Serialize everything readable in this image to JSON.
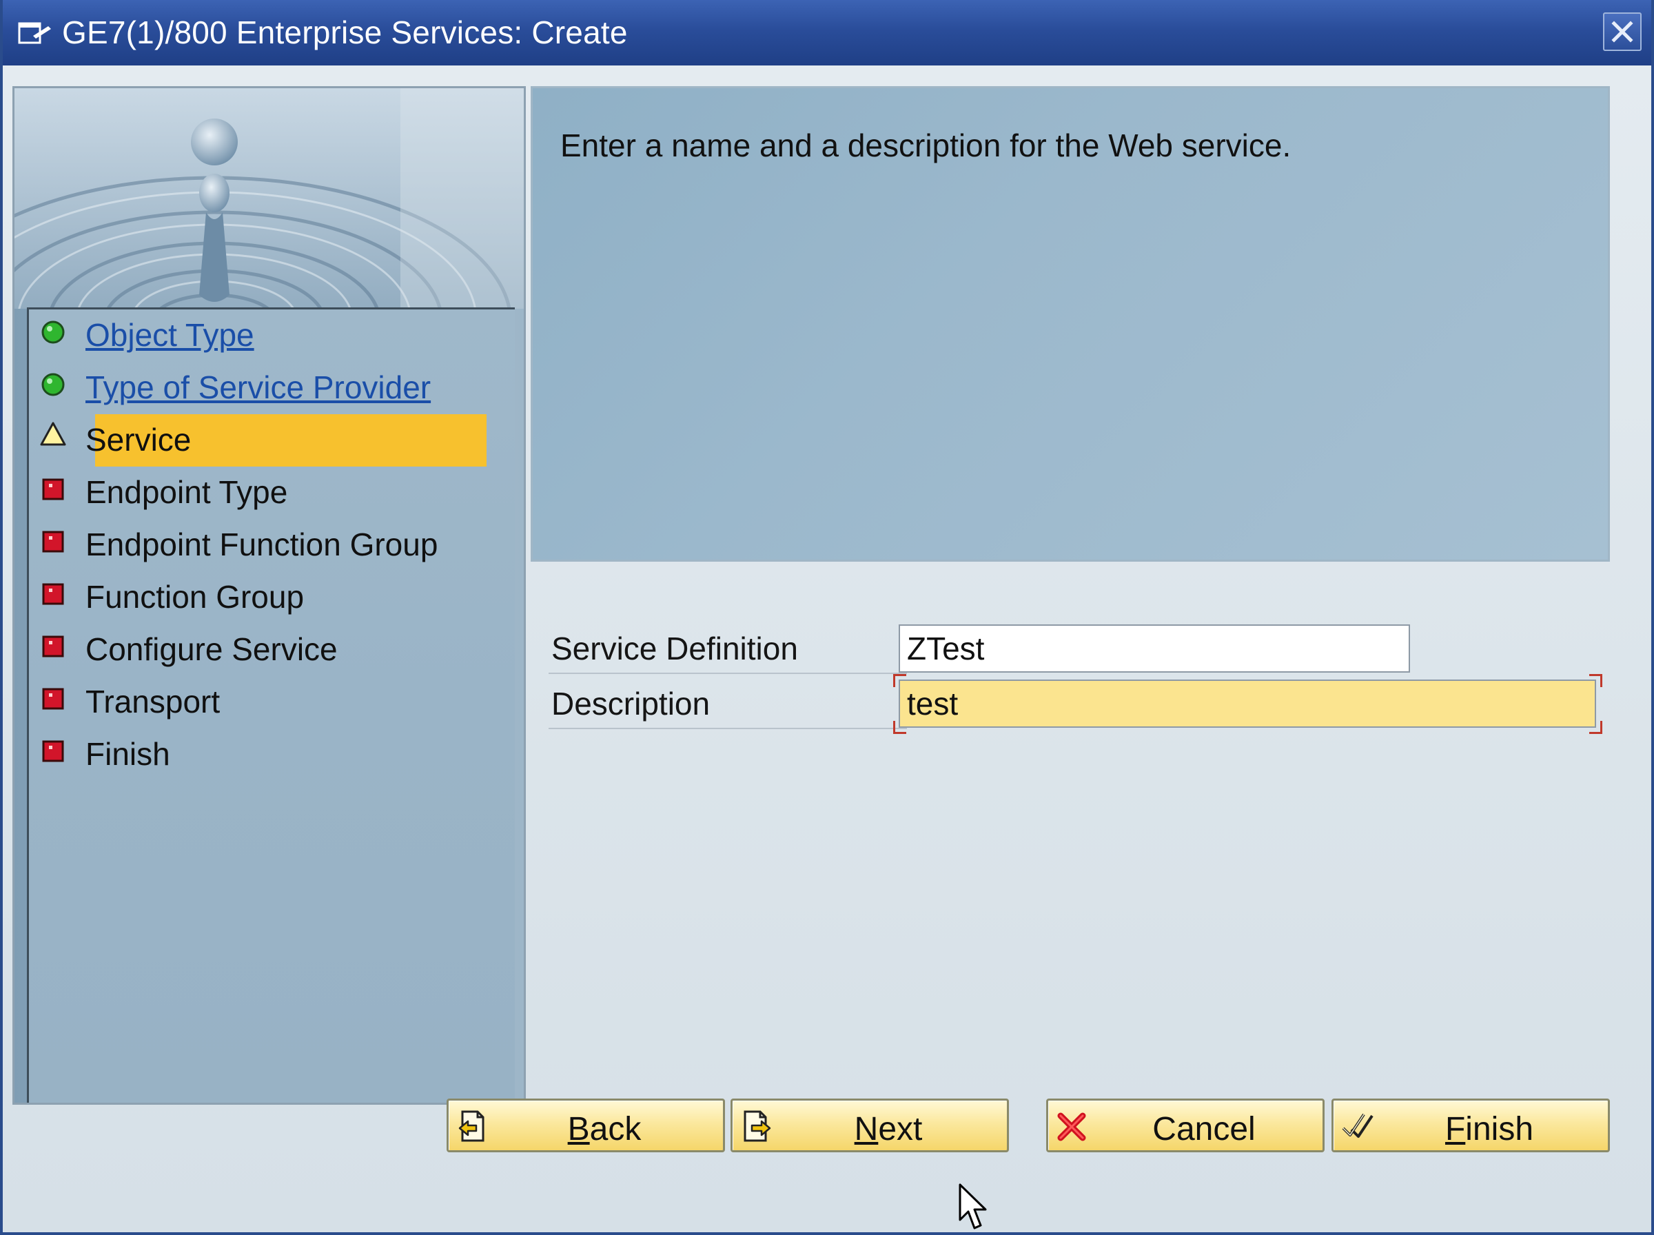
{
  "window": {
    "title": "GE7(1)/800 Enterprise Services: Create",
    "title_icon": "dialog-edit-icon",
    "close_icon": "close-icon"
  },
  "steps": [
    {
      "label": "Object Type",
      "status": "complete",
      "icon": "green-status-dot-icon",
      "link": true
    },
    {
      "label": "Type of Service Provider",
      "status": "complete",
      "icon": "green-status-dot-icon",
      "link": true
    },
    {
      "label": "Service",
      "status": "current",
      "icon": "warning-triangle-icon",
      "link": false
    },
    {
      "label": "Endpoint Type",
      "status": "pending",
      "icon": "red-square-icon",
      "link": false
    },
    {
      "label": "Endpoint Function Group",
      "status": "pending",
      "icon": "red-square-icon",
      "link": false
    },
    {
      "label": "Function Group",
      "status": "pending",
      "icon": "red-square-icon",
      "link": false
    },
    {
      "label": "Configure Service",
      "status": "pending",
      "icon": "red-square-icon",
      "link": false
    },
    {
      "label": "Transport",
      "status": "pending",
      "icon": "red-square-icon",
      "link": false
    },
    {
      "label": "Finish",
      "status": "pending",
      "icon": "red-square-icon",
      "link": false
    }
  ],
  "info": {
    "text": "Enter a name and a description for the Web service."
  },
  "form": {
    "service_definition_label": "Service Definition",
    "service_definition_value": "ZTest",
    "description_label": "Description",
    "description_value": "test"
  },
  "buttons": {
    "back": {
      "mnemonic": "B",
      "rest": "ack",
      "icon": "back-page-icon"
    },
    "next": {
      "mnemonic": "N",
      "rest": "ext",
      "icon": "next-page-icon"
    },
    "cancel": {
      "label": "Cancel",
      "icon": "cancel-x-icon"
    },
    "finish": {
      "mnemonic": "F",
      "rest": "inish",
      "icon": "finish-check-icon"
    }
  },
  "colors": {
    "titlebar": "#2a4d9a",
    "current_step_highlight": "#f7c12e",
    "link": "#1a4ea8",
    "required_field": "#fbe48f",
    "button_face": "#fbe89e"
  }
}
